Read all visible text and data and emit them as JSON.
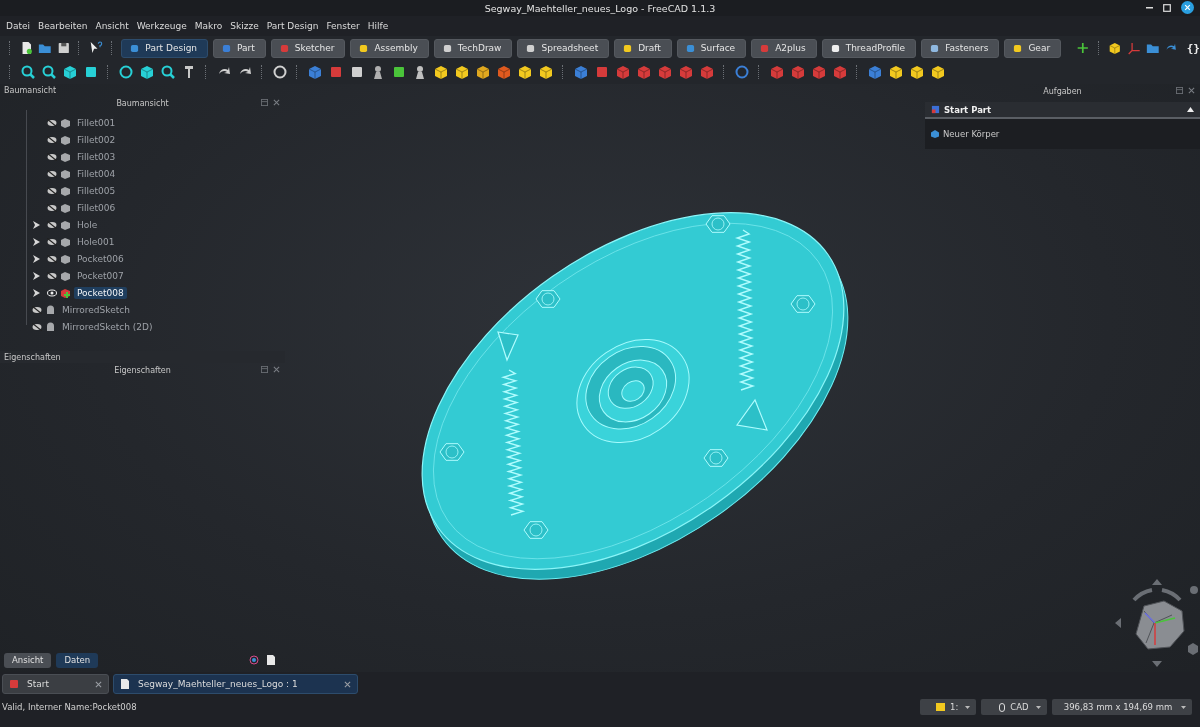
{
  "window": {
    "title": "Segway_Maehteller_neues_Logo - FreeCAD 1.1.3"
  },
  "menu": [
    "Datei",
    "Bearbeiten",
    "Ansicht",
    "Werkzeuge",
    "Makro",
    "Skizze",
    "Part Design",
    "Fenster",
    "Hilfe"
  ],
  "toolbar": {
    "workbenches": [
      {
        "label": "Part Design",
        "selected": true
      },
      {
        "label": "Part",
        "selected": false
      },
      {
        "label": "Sketcher",
        "selected": false
      },
      {
        "label": "Assembly",
        "selected": false
      },
      {
        "label": "TechDraw",
        "selected": false
      },
      {
        "label": "Spreadsheet",
        "selected": false
      },
      {
        "label": "Draft",
        "selected": false
      },
      {
        "label": "Surface",
        "selected": false
      },
      {
        "label": "A2plus",
        "selected": false
      },
      {
        "label": "ThreadProfile",
        "selected": false
      },
      {
        "label": "Fasteners",
        "selected": false
      },
      {
        "label": "Gear",
        "selected": false
      }
    ],
    "macro_label": "{}"
  },
  "tree_panel": {
    "dock_title": "Baumansicht",
    "title": "Baumansicht",
    "items": [
      {
        "label": "Fillet001",
        "kind": "feature",
        "expandable": false,
        "visible": false,
        "selected": false
      },
      {
        "label": "Fillet002",
        "kind": "feature",
        "expandable": false,
        "visible": false,
        "selected": false
      },
      {
        "label": "Fillet003",
        "kind": "feature",
        "expandable": false,
        "visible": false,
        "selected": false
      },
      {
        "label": "Fillet004",
        "kind": "feature",
        "expandable": false,
        "visible": false,
        "selected": false
      },
      {
        "label": "Fillet005",
        "kind": "feature",
        "expandable": false,
        "visible": false,
        "selected": false
      },
      {
        "label": "Fillet006",
        "kind": "feature",
        "expandable": false,
        "visible": false,
        "selected": false
      },
      {
        "label": "Hole",
        "kind": "feature",
        "expandable": true,
        "visible": false,
        "selected": false
      },
      {
        "label": "Hole001",
        "kind": "feature",
        "expandable": true,
        "visible": false,
        "selected": false
      },
      {
        "label": "Pocket006",
        "kind": "feature",
        "expandable": true,
        "visible": false,
        "selected": false
      },
      {
        "label": "Pocket007",
        "kind": "feature",
        "expandable": true,
        "visible": false,
        "selected": false
      },
      {
        "label": "Pocket008",
        "kind": "feature",
        "expandable": true,
        "visible": true,
        "selected": true
      },
      {
        "label": "MirroredSketch",
        "kind": "sketch",
        "expandable": false,
        "visible": false,
        "selected": false
      },
      {
        "label": "MirroredSketch (2D)",
        "kind": "sketch",
        "expandable": false,
        "visible": false,
        "selected": false
      }
    ]
  },
  "properties_panel": {
    "dock_title": "Eigenschaften",
    "title": "Eigenschaften"
  },
  "panel_tabs": [
    {
      "label": "Ansicht",
      "selected": false
    },
    {
      "label": "Daten",
      "selected": true
    }
  ],
  "task_panel": {
    "title": "Aufgaben",
    "section": {
      "title": "Start Part",
      "expanded": true,
      "items": [
        "Neuer Körper"
      ]
    }
  },
  "document_tabs": [
    {
      "label": "Start",
      "selected": false
    },
    {
      "label": "Segway_Maehteller_neues_Logo : 1",
      "selected": true
    }
  ],
  "status_bar": {
    "message": "Valid, Interner Name:Pocket008",
    "zoom_label": "1:",
    "navigation_style": "CAD",
    "dimensions": "396,83 mm x 194,69 mm"
  }
}
